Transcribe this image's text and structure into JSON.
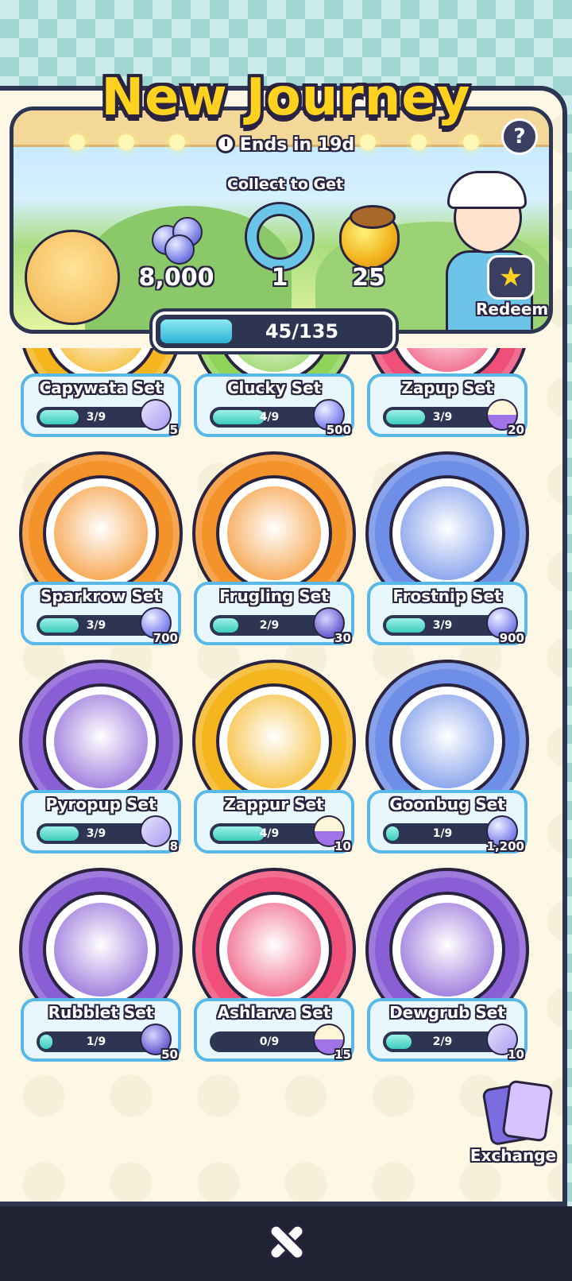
{
  "header": {
    "title": "New Journey",
    "ends_in": "Ends in 19d",
    "collect_label": "Collect to Get",
    "help": "?",
    "redeem_label": "Redeem"
  },
  "rewards": [
    {
      "icon": "orbs-icon",
      "amount": "8,000"
    },
    {
      "icon": "wreath-icon",
      "amount": "1"
    },
    {
      "icon": "acorn-icon",
      "amount": "25"
    }
  ],
  "progress": {
    "text": "45/135",
    "fraction": 0.333
  },
  "sets": [
    {
      "name": "Capywata Set",
      "progress": "3/9",
      "frac": 0.333,
      "reward": "5",
      "reward_icon": "box-icon",
      "ring": "#f5b51f"
    },
    {
      "name": "Clucky Set",
      "progress": "4/9",
      "frac": 0.444,
      "reward": "500",
      "reward_icon": "orbs-icon",
      "ring": "#8fd35b"
    },
    {
      "name": "Zapup Set",
      "progress": "3/9",
      "frac": 0.333,
      "reward": "20",
      "reward_icon": "cake-icon",
      "ring": "#ef4f78"
    },
    {
      "name": "Sparkrow Set",
      "progress": "3/9",
      "frac": 0.333,
      "reward": "700",
      "reward_icon": "orbs-icon",
      "ring": "#f5932b"
    },
    {
      "name": "Frugling Set",
      "progress": "2/9",
      "frac": 0.222,
      "reward": "30",
      "reward_icon": "capsule-icon",
      "ring": "#f5932b"
    },
    {
      "name": "Frostnip Set",
      "progress": "3/9",
      "frac": 0.333,
      "reward": "900",
      "reward_icon": "orbs-icon",
      "ring": "#6e8ee8"
    },
    {
      "name": "Pyropup Set",
      "progress": "3/9",
      "frac": 0.333,
      "reward": "8",
      "reward_icon": "box-icon",
      "ring": "#8a5fd6"
    },
    {
      "name": "Zappur Set",
      "progress": "4/9",
      "frac": 0.444,
      "reward": "10",
      "reward_icon": "cake-icon",
      "ring": "#f5b51f"
    },
    {
      "name": "Goonbug Set",
      "progress": "1/9",
      "frac": 0.111,
      "reward": "1,200",
      "reward_icon": "orbs-icon",
      "ring": "#6e8ee8"
    },
    {
      "name": "Rubblet Set",
      "progress": "1/9",
      "frac": 0.111,
      "reward": "50",
      "reward_icon": "capsule-icon",
      "ring": "#8a5fd6"
    },
    {
      "name": "Ashlarva Set",
      "progress": "0/9",
      "frac": 0.0,
      "reward": "15",
      "reward_icon": "cake-icon",
      "ring": "#ef4f78"
    },
    {
      "name": "Dewgrub Set",
      "progress": "2/9",
      "frac": 0.222,
      "reward": "10",
      "reward_icon": "box-icon",
      "ring": "#8a5fd6"
    }
  ],
  "exchange_label": "Exchange",
  "colors": {
    "accent": "#ffd21f",
    "panel": "#fdf8e6",
    "border": "#2d3552"
  }
}
